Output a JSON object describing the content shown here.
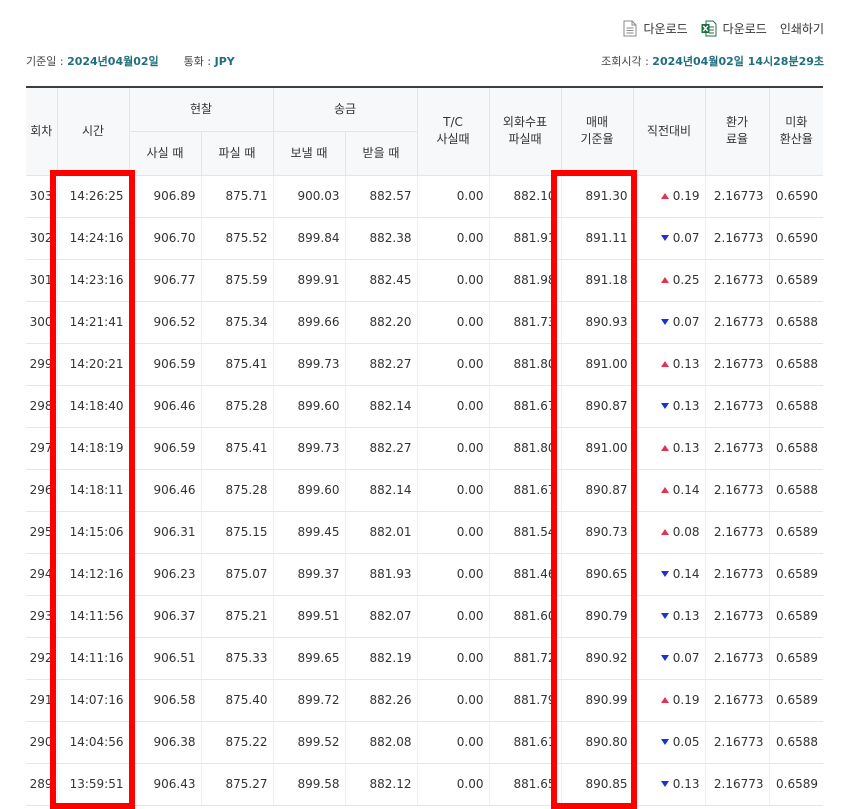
{
  "toolbar": {
    "download_pdf_label": "다운로드",
    "download_excel_label": "다운로드",
    "print_label": "인쇄하기"
  },
  "meta": {
    "base_date_label": "기준일 :",
    "base_date_value": "2024년04월02일",
    "currency_label": "통화 :",
    "currency_value": "JPY",
    "query_time_label": "조회시각 :",
    "query_time_value": "2024년04월02일 14시28분29초"
  },
  "headers": {
    "round": "회차",
    "time": "시간",
    "cash": "현찰",
    "remit": "송금",
    "cash_buy": "사실 때",
    "cash_sell": "파실 때",
    "remit_send": "보낼 때",
    "remit_receive": "받을 때",
    "tc_buy": "T/C\n사실때",
    "check_sell": "외화수표\n파실때",
    "base_rate": "매매\n기준율",
    "change": "직전대비",
    "fee_rate": "환가\n료율",
    "usd_rate": "미화\n환산율"
  },
  "rows": [
    {
      "round": "303",
      "time": "14:26:25",
      "cash_buy": "906.89",
      "cash_sell": "875.71",
      "remit_send": "900.03",
      "remit_receive": "882.57",
      "tc": "0.00",
      "check": "882.10",
      "base": "891.30",
      "dir": "up",
      "change": "0.19",
      "fee": "2.16773",
      "usd": "0.6590"
    },
    {
      "round": "302",
      "time": "14:24:16",
      "cash_buy": "906.70",
      "cash_sell": "875.52",
      "remit_send": "899.84",
      "remit_receive": "882.38",
      "tc": "0.00",
      "check": "881.91",
      "base": "891.11",
      "dir": "down",
      "change": "0.07",
      "fee": "2.16773",
      "usd": "0.6590"
    },
    {
      "round": "301",
      "time": "14:23:16",
      "cash_buy": "906.77",
      "cash_sell": "875.59",
      "remit_send": "899.91",
      "remit_receive": "882.45",
      "tc": "0.00",
      "check": "881.98",
      "base": "891.18",
      "dir": "up",
      "change": "0.25",
      "fee": "2.16773",
      "usd": "0.6589"
    },
    {
      "round": "300",
      "time": "14:21:41",
      "cash_buy": "906.52",
      "cash_sell": "875.34",
      "remit_send": "899.66",
      "remit_receive": "882.20",
      "tc": "0.00",
      "check": "881.73",
      "base": "890.93",
      "dir": "down",
      "change": "0.07",
      "fee": "2.16773",
      "usd": "0.6588"
    },
    {
      "round": "299",
      "time": "14:20:21",
      "cash_buy": "906.59",
      "cash_sell": "875.41",
      "remit_send": "899.73",
      "remit_receive": "882.27",
      "tc": "0.00",
      "check": "881.80",
      "base": "891.00",
      "dir": "up",
      "change": "0.13",
      "fee": "2.16773",
      "usd": "0.6588"
    },
    {
      "round": "298",
      "time": "14:18:40",
      "cash_buy": "906.46",
      "cash_sell": "875.28",
      "remit_send": "899.60",
      "remit_receive": "882.14",
      "tc": "0.00",
      "check": "881.67",
      "base": "890.87",
      "dir": "down",
      "change": "0.13",
      "fee": "2.16773",
      "usd": "0.6588"
    },
    {
      "round": "297",
      "time": "14:18:19",
      "cash_buy": "906.59",
      "cash_sell": "875.41",
      "remit_send": "899.73",
      "remit_receive": "882.27",
      "tc": "0.00",
      "check": "881.80",
      "base": "891.00",
      "dir": "up",
      "change": "0.13",
      "fee": "2.16773",
      "usd": "0.6588"
    },
    {
      "round": "296",
      "time": "14:18:11",
      "cash_buy": "906.46",
      "cash_sell": "875.28",
      "remit_send": "899.60",
      "remit_receive": "882.14",
      "tc": "0.00",
      "check": "881.67",
      "base": "890.87",
      "dir": "up",
      "change": "0.14",
      "fee": "2.16773",
      "usd": "0.6588"
    },
    {
      "round": "295",
      "time": "14:15:06",
      "cash_buy": "906.31",
      "cash_sell": "875.15",
      "remit_send": "899.45",
      "remit_receive": "882.01",
      "tc": "0.00",
      "check": "881.54",
      "base": "890.73",
      "dir": "up",
      "change": "0.08",
      "fee": "2.16773",
      "usd": "0.6589"
    },
    {
      "round": "294",
      "time": "14:12:16",
      "cash_buy": "906.23",
      "cash_sell": "875.07",
      "remit_send": "899.37",
      "remit_receive": "881.93",
      "tc": "0.00",
      "check": "881.46",
      "base": "890.65",
      "dir": "down",
      "change": "0.14",
      "fee": "2.16773",
      "usd": "0.6589"
    },
    {
      "round": "293",
      "time": "14:11:56",
      "cash_buy": "906.37",
      "cash_sell": "875.21",
      "remit_send": "899.51",
      "remit_receive": "882.07",
      "tc": "0.00",
      "check": "881.60",
      "base": "890.79",
      "dir": "down",
      "change": "0.13",
      "fee": "2.16773",
      "usd": "0.6589"
    },
    {
      "round": "292",
      "time": "14:11:16",
      "cash_buy": "906.51",
      "cash_sell": "875.33",
      "remit_send": "899.65",
      "remit_receive": "882.19",
      "tc": "0.00",
      "check": "881.72",
      "base": "890.92",
      "dir": "down",
      "change": "0.07",
      "fee": "2.16773",
      "usd": "0.6589"
    },
    {
      "round": "291",
      "time": "14:07:16",
      "cash_buy": "906.58",
      "cash_sell": "875.40",
      "remit_send": "899.72",
      "remit_receive": "882.26",
      "tc": "0.00",
      "check": "881.79",
      "base": "890.99",
      "dir": "up",
      "change": "0.19",
      "fee": "2.16773",
      "usd": "0.6589"
    },
    {
      "round": "290",
      "time": "14:04:56",
      "cash_buy": "906.38",
      "cash_sell": "875.22",
      "remit_send": "899.52",
      "remit_receive": "882.08",
      "tc": "0.00",
      "check": "881.61",
      "base": "890.80",
      "dir": "down",
      "change": "0.05",
      "fee": "2.16773",
      "usd": "0.6588"
    },
    {
      "round": "289",
      "time": "13:59:51",
      "cash_buy": "906.43",
      "cash_sell": "875.27",
      "remit_send": "899.58",
      "remit_receive": "882.12",
      "tc": "0.00",
      "check": "881.65",
      "base": "890.85",
      "dir": "down",
      "change": "0.13",
      "fee": "2.16773",
      "usd": "0.6589"
    }
  ],
  "icons": {
    "pdf": "document-icon",
    "excel": "excel-icon",
    "up": "triangle-up-icon",
    "down": "triangle-down-icon"
  },
  "colors": {
    "accent": "#1f6f7f",
    "up": "#e0334f",
    "down": "#1e2fd6",
    "highlight": "#ff0000",
    "excel_green": "#1d6f42"
  }
}
